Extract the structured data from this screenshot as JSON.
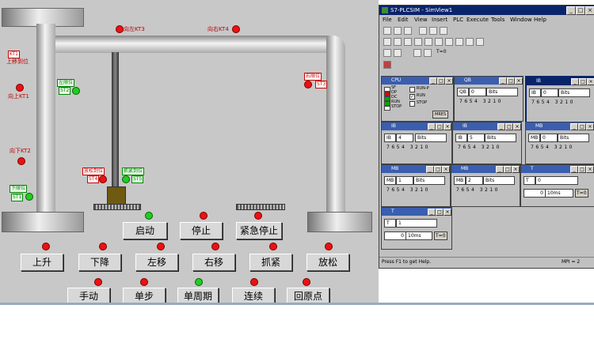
{
  "stage": {
    "bg_color": "#c8c8c8",
    "lamp_red": "#ee1010",
    "lamp_green": "#22cc22",
    "lamps": {
      "left_kt3": "向左KT3",
      "right_kt4": "向右KT4",
      "left_limit_tag": "左限位",
      "right_limit_tag": "右限位",
      "up_limit": {
        "code": "KT1",
        "text": "上移到位"
      },
      "up_kt1": "向上KT1",
      "down_kt2": "向下KT2",
      "lower_limit_tag": "下限位",
      "loosen_tag": "放松到位",
      "clamp_tag": "抓紧到位"
    },
    "small_tags": {
      "a": "ST1",
      "b": "ST2",
      "c": "ST3",
      "d": "ST4",
      "e": "ST5",
      "f": "ST6"
    }
  },
  "buttons": {
    "start": "启动",
    "stop": "停止",
    "emergency_stop": "紧急停止",
    "up": "上升",
    "down": "下降",
    "left": "左移",
    "right": "右移",
    "clamp": "抓紧",
    "loosen": "放松",
    "manual": "手动",
    "single_step": "单步",
    "single_cycle": "单周期",
    "continuous": "连续",
    "home": "回原点"
  },
  "sim": {
    "title": "S7-PLCSIM - SimView1",
    "title_bg": "#0a246a",
    "win_min": "_",
    "win_max": "□",
    "win_close": "×",
    "menus": [
      "File",
      "Edit",
      "View",
      "Insert",
      "PLC",
      "Execute",
      "Tools",
      "Window",
      "Help"
    ],
    "run_mode_label": "T=0",
    "cpu": {
      "title": "CPU",
      "modes": [
        "SF",
        "DP",
        "DC",
        "RUN",
        "STOP"
      ],
      "options": [
        "RUN-P",
        "RUN",
        "STOP"
      ],
      "mres": "MRES"
    },
    "panels": [
      {
        "title": "QB",
        "addr": "0",
        "fmt": "Bits",
        "bits": "7 6 5 4   3 2 1 0"
      },
      {
        "title": "IB",
        "addr": "0",
        "fmt": "Bits",
        "bits": "7 6 5 4   3 2 1 0"
      },
      {
        "title": "IB",
        "addr": "4",
        "fmt": "Bits",
        "bits": "7 6 5 4   3 2 1 0"
      },
      {
        "title": "IB",
        "addr": "5",
        "fmt": "Bits",
        "bits": "7 6 5 4   3 2 1 0"
      },
      {
        "title": "MB",
        "addr": "0",
        "fmt": "Bits",
        "bits": "7 6 5 4   3 2 1 0"
      },
      {
        "title": "MB",
        "addr": "1",
        "fmt": "Bits",
        "bits": "7 6 5 4   3 2 1 0"
      },
      {
        "title": "MB",
        "addr": "2",
        "fmt": "Bits",
        "bits": "7 6 5 4   3 2 1 0"
      }
    ],
    "timers": [
      {
        "title": "T",
        "addr": "0",
        "value": "0",
        "base": "10ms",
        "reset": "T=0"
      },
      {
        "title": "T",
        "addr": "1",
        "value": "0",
        "base": "10ms",
        "reset": "T=0"
      }
    ],
    "status_left": "Press F1 to get Help.",
    "status_right": "MPI = 2"
  }
}
